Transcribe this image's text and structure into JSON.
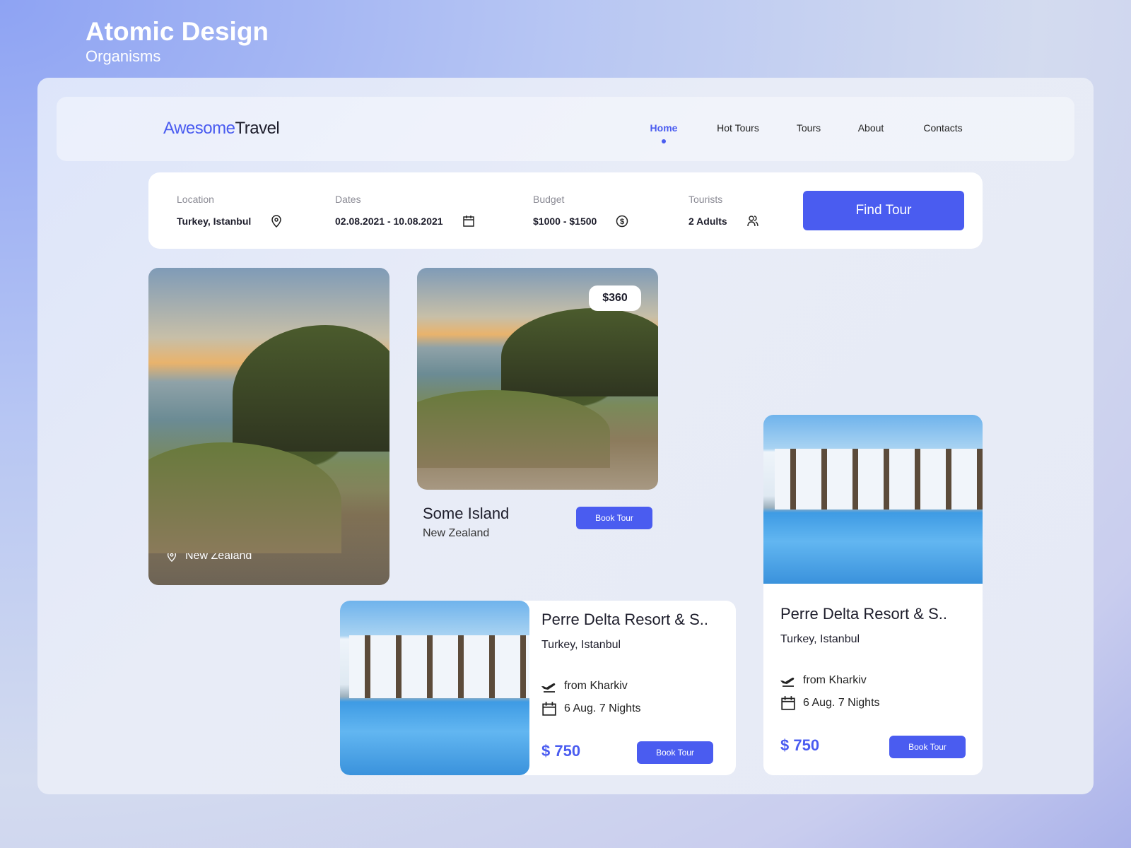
{
  "header": {
    "title": "Atomic Design",
    "subtitle": "Organisms"
  },
  "nav": {
    "logo_part1": "Awesome",
    "logo_part2": "Travel",
    "items": [
      {
        "label": "Home",
        "active": true
      },
      {
        "label": "Hot Tours"
      },
      {
        "label": "Tours"
      },
      {
        "label": "About"
      },
      {
        "label": "Contacts"
      }
    ]
  },
  "search": {
    "location": {
      "label": "Location",
      "value": "Turkey, Istanbul",
      "icon": "map-pin-icon"
    },
    "dates": {
      "label": "Dates",
      "value": "02.08.2021 - 10.08.2021",
      "icon": "calendar-icon"
    },
    "budget": {
      "label": "Budget",
      "value": "$1000 - $1500",
      "icon": "dollar-circle-icon"
    },
    "tourists": {
      "label": "Tourists",
      "value": "2 Adults",
      "icon": "users-icon"
    },
    "button": "Find Tour"
  },
  "cards": [
    {
      "title": "Some Island",
      "location": "New Zealand"
    },
    {
      "title": "Some Island",
      "location": "New Zealand",
      "price": "$360",
      "button": "Book Tour"
    },
    {
      "title": "Perre Delta Resort & S..",
      "location": "Turkey, Istanbul",
      "from": "from Kharkiv",
      "dates": "6 Aug. 7 Nights",
      "price": "$ 750",
      "button": "Book Tour"
    },
    {
      "title": "Perre Delta Resort & S..",
      "location": "Turkey, Istanbul",
      "from": "from Kharkiv",
      "dates": "6 Aug. 7 Nights",
      "price": "$ 750",
      "button": "Book Tour"
    }
  ],
  "colors": {
    "accent": "#4a5cf0"
  }
}
